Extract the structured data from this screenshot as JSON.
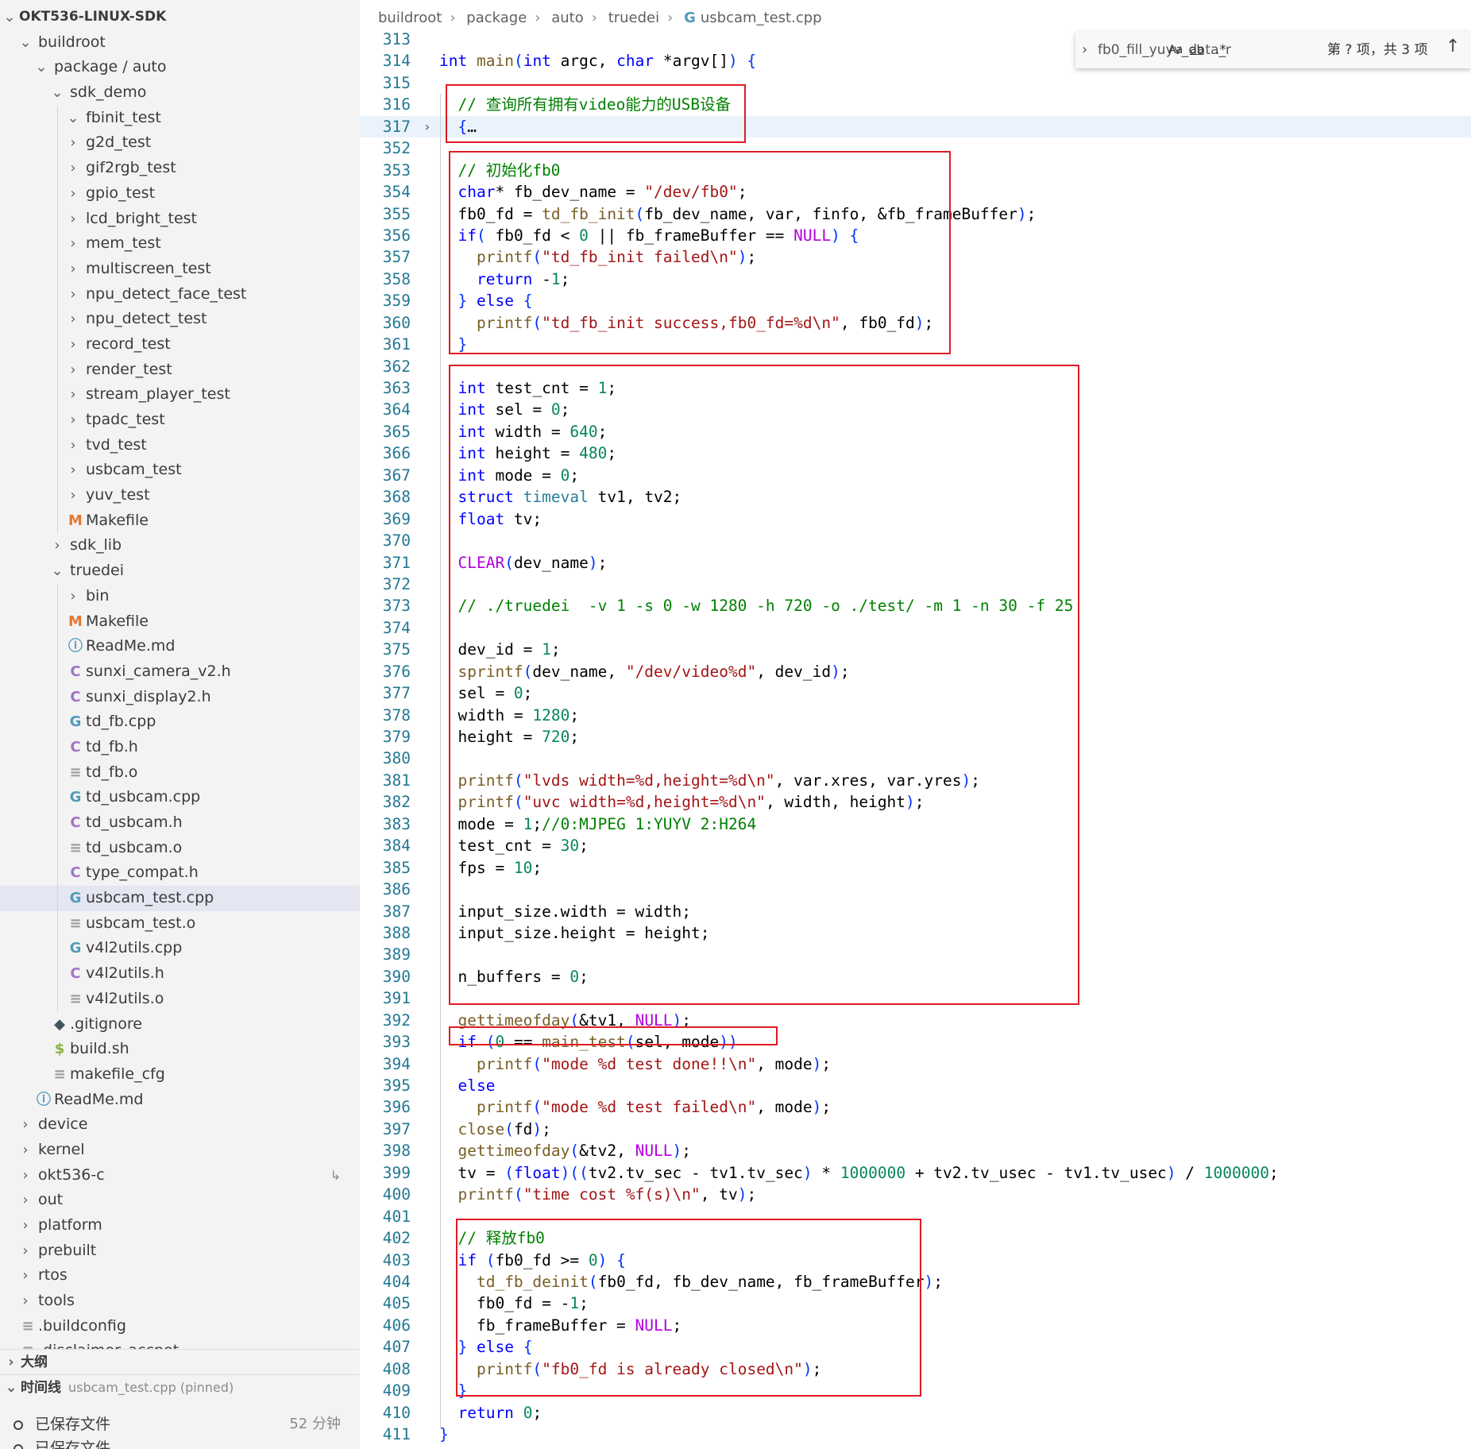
{
  "sidebar": {
    "root": "OKT536-LINUX-SDK",
    "tree": [
      {
        "label": "buildroot",
        "depth": 1,
        "type": "folder",
        "expanded": true
      },
      {
        "label": "package / auto",
        "depth": 2,
        "type": "folder",
        "expanded": true
      },
      {
        "label": "sdk_demo",
        "depth": 3,
        "type": "folder",
        "expanded": true
      },
      {
        "label": "fbinit_test",
        "depth": 4,
        "type": "folder",
        "expanded": true
      },
      {
        "label": "g2d_test",
        "depth": 4,
        "type": "folder"
      },
      {
        "label": "gif2rgb_test",
        "depth": 4,
        "type": "folder"
      },
      {
        "label": "gpio_test",
        "depth": 4,
        "type": "folder"
      },
      {
        "label": "lcd_bright_test",
        "depth": 4,
        "type": "folder"
      },
      {
        "label": "mem_test",
        "depth": 4,
        "type": "folder"
      },
      {
        "label": "multiscreen_test",
        "depth": 4,
        "type": "folder"
      },
      {
        "label": "npu_detect_face_test",
        "depth": 4,
        "type": "folder"
      },
      {
        "label": "npu_detect_test",
        "depth": 4,
        "type": "folder"
      },
      {
        "label": "record_test",
        "depth": 4,
        "type": "folder"
      },
      {
        "label": "render_test",
        "depth": 4,
        "type": "folder"
      },
      {
        "label": "stream_player_test",
        "depth": 4,
        "type": "folder"
      },
      {
        "label": "tpadc_test",
        "depth": 4,
        "type": "folder"
      },
      {
        "label": "tvd_test",
        "depth": 4,
        "type": "folder"
      },
      {
        "label": "usbcam_test",
        "depth": 4,
        "type": "folder"
      },
      {
        "label": "yuv_test",
        "depth": 4,
        "type": "folder"
      },
      {
        "label": "Makefile",
        "depth": 4,
        "type": "file",
        "icon": "M",
        "icon_color": "#e37933"
      },
      {
        "label": "sdk_lib",
        "depth": 3,
        "type": "folder"
      },
      {
        "label": "truedei",
        "depth": 3,
        "type": "folder",
        "expanded": true
      },
      {
        "label": "bin",
        "depth": 4,
        "type": "folder"
      },
      {
        "label": "Makefile",
        "depth": 4,
        "type": "file",
        "icon": "M",
        "icon_color": "#e37933"
      },
      {
        "label": "ReadMe.md",
        "depth": 4,
        "type": "file",
        "icon": "ⓘ",
        "icon_color": "#519aba"
      },
      {
        "label": "sunxi_camera_v2.h",
        "depth": 4,
        "type": "file",
        "icon": "C",
        "icon_color": "#a074c4"
      },
      {
        "label": "sunxi_display2.h",
        "depth": 4,
        "type": "file",
        "icon": "C",
        "icon_color": "#a074c4"
      },
      {
        "label": "td_fb.cpp",
        "depth": 4,
        "type": "file",
        "icon": "G",
        "icon_color": "#519aba"
      },
      {
        "label": "td_fb.h",
        "depth": 4,
        "type": "file",
        "icon": "C",
        "icon_color": "#a074c4"
      },
      {
        "label": "td_fb.o",
        "depth": 4,
        "type": "file",
        "icon": "≡",
        "icon_color": "#9a9a9a"
      },
      {
        "label": "td_usbcam.cpp",
        "depth": 4,
        "type": "file",
        "icon": "G",
        "icon_color": "#519aba"
      },
      {
        "label": "td_usbcam.h",
        "depth": 4,
        "type": "file",
        "icon": "C",
        "icon_color": "#a074c4"
      },
      {
        "label": "td_usbcam.o",
        "depth": 4,
        "type": "file",
        "icon": "≡",
        "icon_color": "#9a9a9a"
      },
      {
        "label": "type_compat.h",
        "depth": 4,
        "type": "file",
        "icon": "C",
        "icon_color": "#a074c4"
      },
      {
        "label": "usbcam_test.cpp",
        "depth": 4,
        "type": "file",
        "icon": "G",
        "icon_color": "#519aba",
        "active": true
      },
      {
        "label": "usbcam_test.o",
        "depth": 4,
        "type": "file",
        "icon": "≡",
        "icon_color": "#9a9a9a"
      },
      {
        "label": "v4l2utils.cpp",
        "depth": 4,
        "type": "file",
        "icon": "G",
        "icon_color": "#519aba"
      },
      {
        "label": "v4l2utils.h",
        "depth": 4,
        "type": "file",
        "icon": "C",
        "icon_color": "#a074c4"
      },
      {
        "label": "v4l2utils.o",
        "depth": 4,
        "type": "file",
        "icon": "≡",
        "icon_color": "#9a9a9a"
      },
      {
        "label": ".gitignore",
        "depth": 3,
        "type": "file",
        "icon": "◆",
        "icon_color": "#41535b"
      },
      {
        "label": "build.sh",
        "depth": 3,
        "type": "file",
        "icon": "$",
        "icon_color": "#89b43c"
      },
      {
        "label": "makefile_cfg",
        "depth": 3,
        "type": "file",
        "icon": "≡",
        "icon_color": "#9a9a9a"
      },
      {
        "label": "ReadMe.md",
        "depth": 2,
        "type": "file",
        "icon": "ⓘ",
        "icon_color": "#519aba"
      },
      {
        "label": "device",
        "depth": 1,
        "type": "folder"
      },
      {
        "label": "kernel",
        "depth": 1,
        "type": "folder"
      },
      {
        "label": "okt536-c",
        "depth": 1,
        "type": "folder",
        "badge": "↳"
      },
      {
        "label": "out",
        "depth": 1,
        "type": "folder"
      },
      {
        "label": "platform",
        "depth": 1,
        "type": "folder"
      },
      {
        "label": "prebuilt",
        "depth": 1,
        "type": "folder"
      },
      {
        "label": "rtos",
        "depth": 1,
        "type": "folder"
      },
      {
        "label": "tools",
        "depth": 1,
        "type": "folder"
      },
      {
        "label": ".buildconfig",
        "depth": 1,
        "type": "file",
        "icon": "≡",
        "icon_color": "#9a9a9a"
      },
      {
        "label": ".disclaimer_accpet",
        "depth": 1,
        "type": "file",
        "icon": "≡",
        "icon_color": "#9a9a9a"
      }
    ],
    "outline_label": "大纲",
    "timeline_label": "时间线",
    "timeline_pinned": "usbcam_test.cpp (pinned)",
    "timeline_items": [
      {
        "label": "已保存文件",
        "time": "52 分钟"
      },
      {
        "label": "已保存文件",
        "time": ""
      }
    ]
  },
  "breadcrumb": [
    "buildroot",
    "package",
    "auto",
    "truedei",
    "usbcam_test.cpp"
  ],
  "find_widget": {
    "query": "fb0_fill_yuyv_data_r",
    "opt_case": "Aa",
    "opt_word": "ab",
    "opt_regex": ".*",
    "result": "第 ? 项，共 3 项"
  },
  "code_lines": [
    {
      "n": "313",
      "h": ""
    },
    {
      "n": "314",
      "h": "<span class='kw'>int</span> <span class='fn'>main</span><span class='p'>(</span><span class='kw'>int</span> argc, <span class='kw'>char</span> *argv[]<span class='p'>)</span> <span class='p'>{</span>"
    },
    {
      "n": "315",
      "h": ""
    },
    {
      "n": "316",
      "h": "  <span class='cm'>// 查询所有拥有video能力的USB设备</span>"
    },
    {
      "n": "317",
      "h": "  <span class='p'>{</span>…",
      "fold": true,
      "hl": true
    },
    {
      "n": "352",
      "h": ""
    },
    {
      "n": "353",
      "h": "  <span class='cm'>// 初始化fb0</span>"
    },
    {
      "n": "354",
      "h": "  <span class='kw'>char</span>* fb_dev_name = <span class='str'>\"/dev/fb0\"</span>;"
    },
    {
      "n": "355",
      "h": "  fb0_fd = <span class='fn'>td_fb_init</span><span class='p'>(</span>fb_dev_name, var, finfo, &amp;fb_frameBuffer<span class='p'>)</span>;"
    },
    {
      "n": "356",
      "h": "  <span class='kw'>if</span><span class='p'>(</span> fb0_fd &lt; <span class='num'>0</span> || fb_frameBuffer == <span class='mac'>NULL</span><span class='p'>)</span> <span class='p'>{</span>"
    },
    {
      "n": "357",
      "h": "    <span class='fn'>printf</span><span class='p'>(</span><span class='str'>\"td_fb_init failed\\n\"</span><span class='p'>)</span>;"
    },
    {
      "n": "358",
      "h": "    <span class='kw'>return</span> -<span class='num'>1</span>;"
    },
    {
      "n": "359",
      "h": "  <span class='p'>}</span> <span class='kw'>else</span> <span class='p'>{</span>"
    },
    {
      "n": "360",
      "h": "    <span class='fn'>printf</span><span class='p'>(</span><span class='str'>\"td_fb_init success,fb0_fd=%d\\n\"</span>, fb0_fd<span class='p'>)</span>;"
    },
    {
      "n": "361",
      "h": "  <span class='p'>}</span>"
    },
    {
      "n": "362",
      "h": ""
    },
    {
      "n": "363",
      "h": "  <span class='kw'>int</span> test_cnt = <span class='num'>1</span>;"
    },
    {
      "n": "364",
      "h": "  <span class='kw'>int</span> sel = <span class='num'>0</span>;"
    },
    {
      "n": "365",
      "h": "  <span class='kw'>int</span> width = <span class='num'>640</span>;"
    },
    {
      "n": "366",
      "h": "  <span class='kw'>int</span> height = <span class='num'>480</span>;"
    },
    {
      "n": "367",
      "h": "  <span class='kw'>int</span> mode = <span class='num'>0</span>;"
    },
    {
      "n": "368",
      "h": "  <span class='kw'>struct</span> <span class='ty'>timeval</span> tv1, tv2;"
    },
    {
      "n": "369",
      "h": "  <span class='kw'>float</span> tv;"
    },
    {
      "n": "370",
      "h": ""
    },
    {
      "n": "371",
      "h": "  <span class='mac'>CLEAR</span><span class='p'>(</span>dev_name<span class='p'>)</span>;"
    },
    {
      "n": "372",
      "h": ""
    },
    {
      "n": "373",
      "h": "  <span class='cm'>// ./truedei  -v 1 -s 0 -w 1280 -h 720 -o ./test/ -m 1 -n 30 -f 25</span>"
    },
    {
      "n": "374",
      "h": ""
    },
    {
      "n": "375",
      "h": "  dev_id = <span class='num'>1</span>;"
    },
    {
      "n": "376",
      "h": "  <span class='fn'>sprintf</span><span class='p'>(</span>dev_name, <span class='str'>\"/dev/video%d\"</span>, dev_id<span class='p'>)</span>;"
    },
    {
      "n": "377",
      "h": "  sel = <span class='num'>0</span>;"
    },
    {
      "n": "378",
      "h": "  width = <span class='num'>1280</span>;"
    },
    {
      "n": "379",
      "h": "  height = <span class='num'>720</span>;"
    },
    {
      "n": "380",
      "h": ""
    },
    {
      "n": "381",
      "h": "  <span class='fn'>printf</span><span class='p'>(</span><span class='str'>\"lvds width=%d,height=%d\\n\"</span>, var.xres, var.yres<span class='p'>)</span>;"
    },
    {
      "n": "382",
      "h": "  <span class='fn'>printf</span><span class='p'>(</span><span class='str'>\"uvc width=%d,height=%d\\n\"</span>, width, height<span class='p'>)</span>;"
    },
    {
      "n": "383",
      "h": "  mode = <span class='num'>1</span>;<span class='cm'>//0:MJPEG 1:YUYV 2:H264</span>"
    },
    {
      "n": "384",
      "h": "  test_cnt = <span class='num'>30</span>;"
    },
    {
      "n": "385",
      "h": "  fps = <span class='num'>10</span>;"
    },
    {
      "n": "386",
      "h": ""
    },
    {
      "n": "387",
      "h": "  input_size.width = width;"
    },
    {
      "n": "388",
      "h": "  input_size.height = height;"
    },
    {
      "n": "389",
      "h": ""
    },
    {
      "n": "390",
      "h": "  n_buffers = <span class='num'>0</span>;"
    },
    {
      "n": "391",
      "h": ""
    },
    {
      "n": "392",
      "h": "  <span class='fn'>gettimeofday</span><span class='p'>(</span>&amp;tv1, <span class='mac'>NULL</span><span class='p'>)</span>;"
    },
    {
      "n": "393",
      "h": "  <span class='kw'>if</span> <span class='p'>(</span><span class='num'>0</span> == <span class='fn'>main_test</span><span class='p'>(</span>sel, mode<span class='p'>))</span>"
    },
    {
      "n": "394",
      "h": "    <span class='fn'>printf</span><span class='p'>(</span><span class='str'>\"mode %d test done!!\\n\"</span>, mode<span class='p'>)</span>;"
    },
    {
      "n": "395",
      "h": "  <span class='kw'>else</span>"
    },
    {
      "n": "396",
      "h": "    <span class='fn'>printf</span><span class='p'>(</span><span class='str'>\"mode %d test failed\\n\"</span>, mode<span class='p'>)</span>;"
    },
    {
      "n": "397",
      "h": "  <span class='fn'>close</span><span class='p'>(</span>fd<span class='p'>)</span>;"
    },
    {
      "n": "398",
      "h": "  <span class='fn'>gettimeofday</span><span class='p'>(</span>&amp;tv2, <span class='mac'>NULL</span><span class='p'>)</span>;"
    },
    {
      "n": "399",
      "h": "  tv = <span class='p'>(</span><span class='kw'>float</span><span class='p'>)((</span>tv2.tv_sec - tv1.tv_sec<span class='p'>)</span> * <span class='num'>1000000</span> + tv2.tv_usec - tv1.tv_usec<span class='p'>)</span> / <span class='num'>1000000</span>;"
    },
    {
      "n": "400",
      "h": "  <span class='fn'>printf</span><span class='p'>(</span><span class='str'>\"time cost %f(s)\\n\"</span>, tv<span class='p'>)</span>;"
    },
    {
      "n": "401",
      "h": ""
    },
    {
      "n": "402",
      "h": "  <span class='cm'>// 释放fb0</span>"
    },
    {
      "n": "403",
      "h": "  <span class='kw'>if</span> <span class='p'>(</span>fb0_fd &gt;= <span class='num'>0</span><span class='p'>)</span> <span class='p'>{</span>"
    },
    {
      "n": "404",
      "h": "    <span class='fn'>td_fb_deinit</span><span class='p'>(</span>fb0_fd, fb_dev_name, fb_frameBuffer<span class='p'>)</span>;"
    },
    {
      "n": "405",
      "h": "    fb0_fd = -<span class='num'>1</span>;"
    },
    {
      "n": "406",
      "h": "    fb_frameBuffer = <span class='mac'>NULL</span>;"
    },
    {
      "n": "407",
      "h": "  <span class='p'>}</span> <span class='kw'>else</span> <span class='p'>{</span>"
    },
    {
      "n": "408",
      "h": "    <span class='fn'>printf</span><span class='p'>(</span><span class='str'>\"fb0_fd is already closed\\n\"</span><span class='p'>)</span>;"
    },
    {
      "n": "409",
      "h": "  <span class='p'>}</span>"
    },
    {
      "n": "410",
      "h": "  <span class='kw'>return</span> <span class='num'>0</span>;"
    },
    {
      "n": "411",
      "h": "<span class='p'>}</span>"
    }
  ]
}
